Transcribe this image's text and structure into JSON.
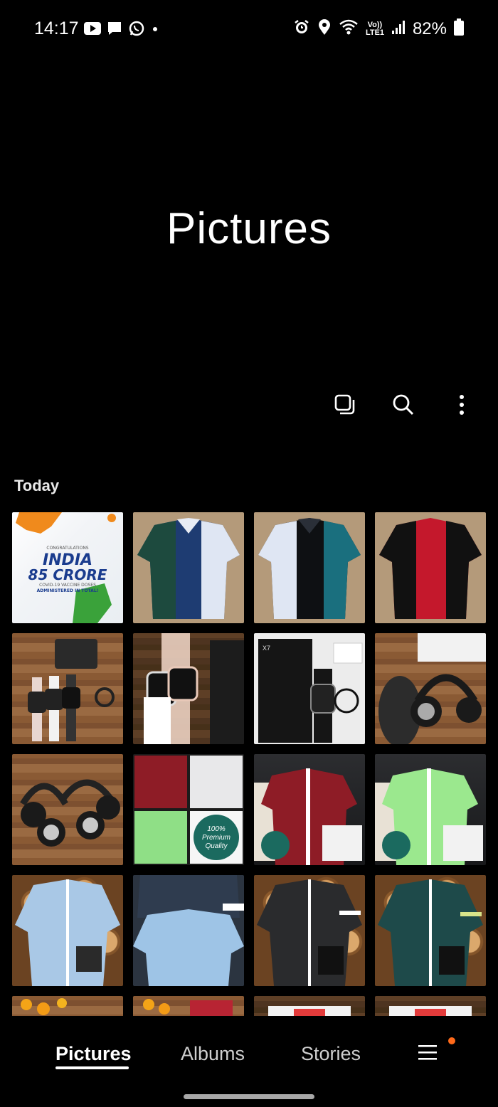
{
  "status_bar": {
    "time": "14:17",
    "battery": "82%",
    "network_label": "Vo)) LTE1",
    "left_icons": [
      "youtube-icon",
      "message-icon",
      "whatsapp-icon",
      "dot-icon"
    ],
    "right_icons": [
      "alarm-icon",
      "location-icon",
      "wifi-icon",
      "signal-icon",
      "battery-icon"
    ]
  },
  "page": {
    "title": "Pictures"
  },
  "toolbar": {
    "icons": [
      "select-icon",
      "search-icon",
      "more-icon"
    ]
  },
  "section": {
    "label": "Today"
  },
  "thumbnails": [
    {
      "subject": "india-85-crore-banner",
      "text_1": "CONGRATULATIONS",
      "text_2": "INDIA",
      "text_3": "85 CRORE",
      "text_4": "COVID-19 VACCINE DOSES",
      "text_5": "ADMINISTERED IN TOTAL!"
    },
    {
      "subject": "green-navy-white-shirt"
    },
    {
      "subject": "white-black-teal-shirt"
    },
    {
      "subject": "black-red-black-shirt"
    },
    {
      "subject": "smartwatches-on-wood"
    },
    {
      "subject": "smartwatches-in-hand"
    },
    {
      "subject": "smartwatch-box",
      "text_1": "X7"
    },
    {
      "subject": "headphones-with-box"
    },
    {
      "subject": "two-headphones-on-wood"
    },
    {
      "subject": "shirt-collage",
      "text_1": "100%",
      "text_2": "Premium",
      "text_3": "Quality"
    },
    {
      "subject": "maroon-check-shirt"
    },
    {
      "subject": "green-check-shirt"
    },
    {
      "subject": "light-denim-shirt"
    },
    {
      "subject": "denim-shirts-stack"
    },
    {
      "subject": "black-denim-shirt"
    },
    {
      "subject": "teal-denim-shirt"
    },
    {
      "subject": "flowers-partial"
    },
    {
      "subject": "flowers-shirt-partial"
    },
    {
      "subject": "partial-box"
    },
    {
      "subject": "partial-box-2"
    }
  ],
  "nav": {
    "tabs": [
      "Pictures",
      "Albums",
      "Stories"
    ],
    "active": "Pictures",
    "menu_icon": "menu-icon",
    "badge_color": "#ff6a1a"
  }
}
